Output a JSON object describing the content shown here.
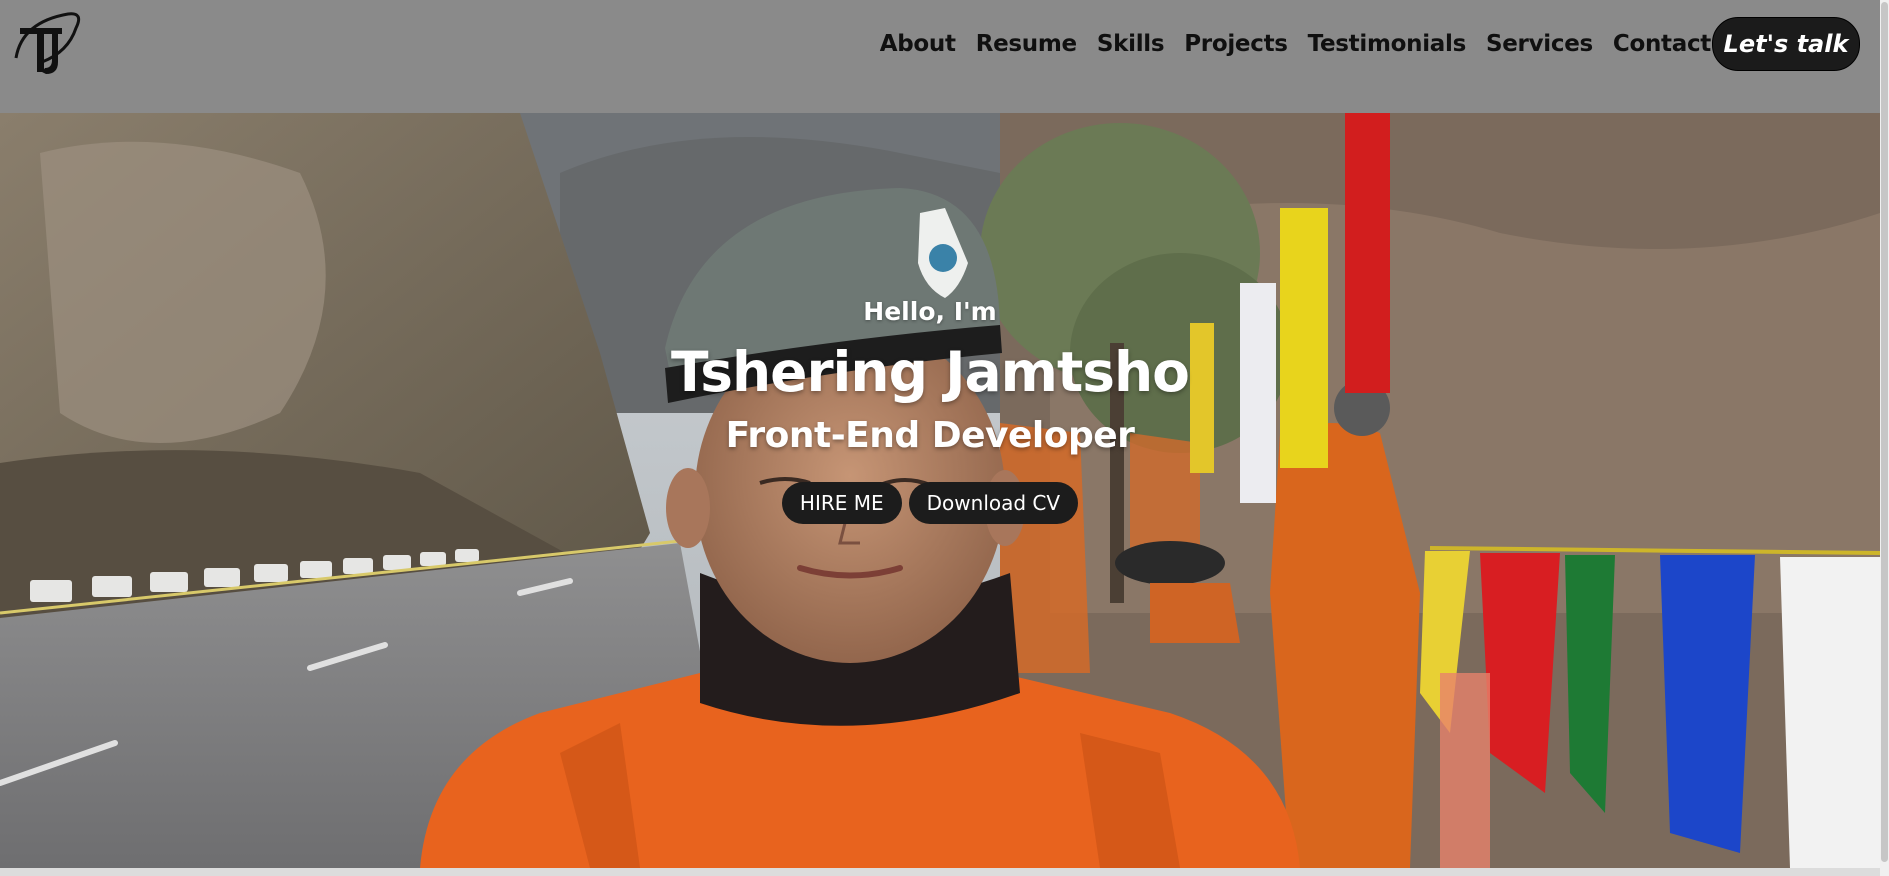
{
  "header": {
    "logo_text": "TJ",
    "nav": [
      "About",
      "Resume",
      "Skills",
      "Projects",
      "Testimonials",
      "Services",
      "Contact"
    ],
    "cta_label": "Let's talk"
  },
  "hero": {
    "greeting": "Hello, I'm",
    "name": "Tshering Jamtsho",
    "role": "Front-End Developer",
    "buttons": [
      "HIRE ME",
      "Download CV"
    ],
    "background": "photo-of-person-in-orange-uniform-and-beret-with-prayer-flags"
  },
  "colors": {
    "header_bg": "#8a8a8a",
    "button_bg": "#1c1c1c",
    "text_light": "#ffffff",
    "nav_text": "#101010"
  }
}
